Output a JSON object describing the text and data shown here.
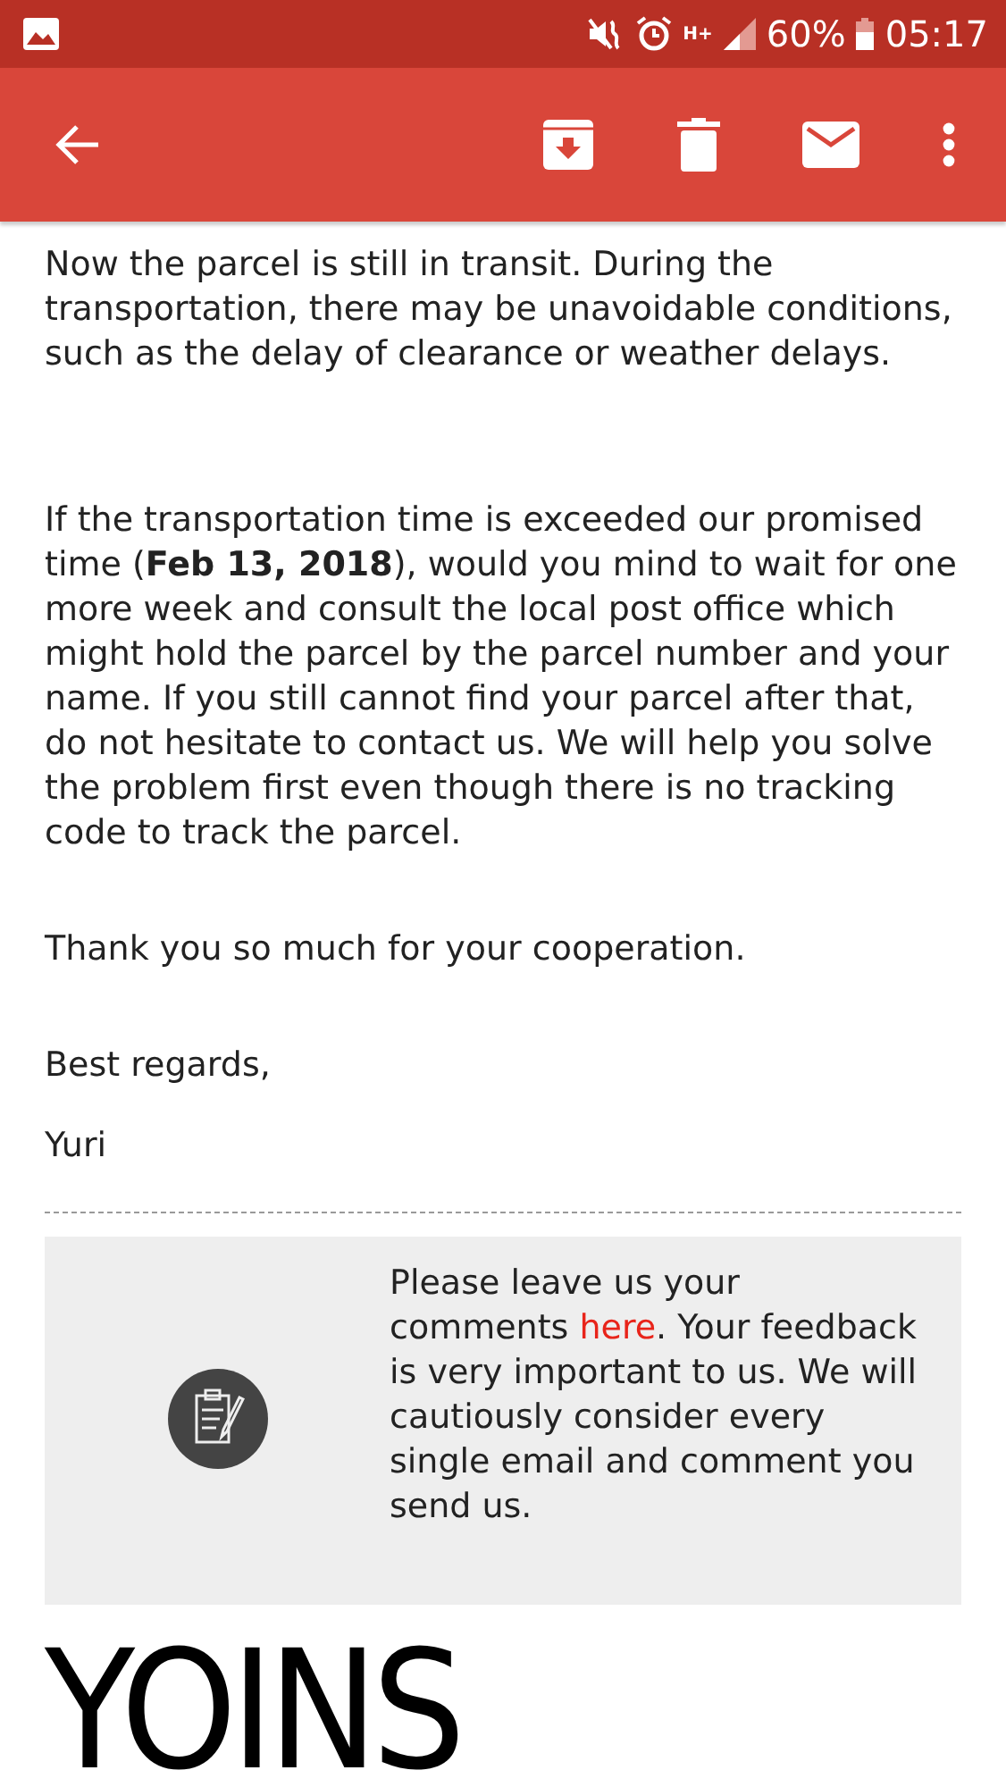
{
  "status_bar": {
    "network": "H+",
    "battery": "60%",
    "time": "05:17"
  },
  "email": {
    "paragraphs": [
      "Now the parcel is still in transit. During the transportation, there may be unavoidable conditions, such as the delay of clearance or weather delays.",
      "If the transportation time is exceeded our promised time (**Feb 13, 2018**), would you mind to wait for one more week and consult the local post office which might hold the parcel by the parcel number and your name. If you still cannot find your parcel after that, do not hesitate to contact us. We will help you solve the problem first even though there is no tracking code to track the parcel.",
      "Thank you so much for your cooperation.",
      "Best regards,",
      "Yuri"
    ]
  },
  "feedback": {
    "before": "Please leave us your comments ",
    "link": "here",
    "after": ". Your feedback is very important to us. We will cautiously consider every single email and comment you send us."
  },
  "logo": "YOINS"
}
